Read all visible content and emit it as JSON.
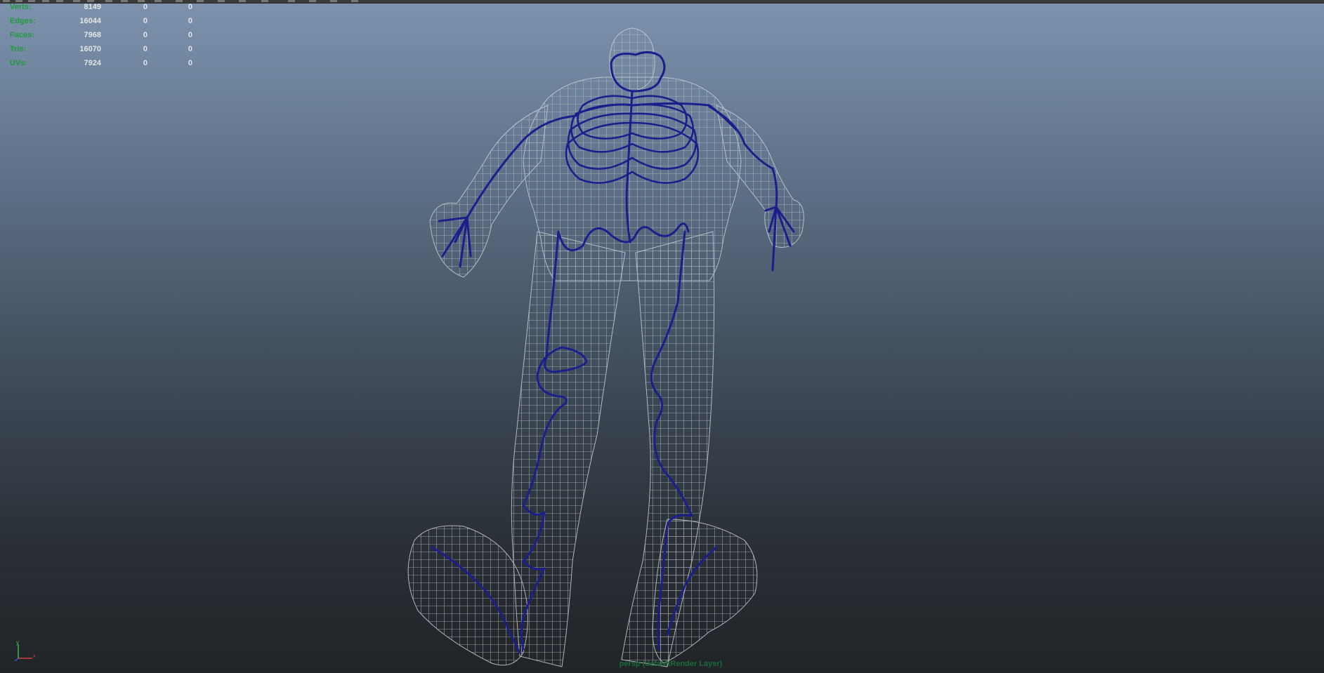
{
  "hud": {
    "rows": [
      {
        "label": "Verts:",
        "v1": "8149",
        "v2": "0",
        "v3": "0"
      },
      {
        "label": "Edges:",
        "v1": "16044",
        "v2": "0",
        "v3": "0"
      },
      {
        "label": "Faces:",
        "v1": "7968",
        "v2": "0",
        "v3": "0"
      },
      {
        "label": "Tris:",
        "v1": "16070",
        "v2": "0",
        "v3": "0"
      },
      {
        "label": "UVs:",
        "v1": "7924",
        "v2": "0",
        "v3": "0"
      }
    ]
  },
  "viewport": {
    "camera_label": "persp (defaultRender Layer)",
    "axis": {
      "x": "x",
      "y": "y"
    },
    "colors": {
      "wireframe": "#b8bec6",
      "curves": "#1a1f8c",
      "hud_label": "#1f9c3c",
      "hud_value": "#e4e4e4"
    }
  }
}
